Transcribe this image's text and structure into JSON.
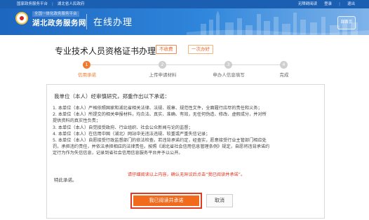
{
  "topbar": {
    "site_name": "国家政务服务平台",
    "province_portal": "湖北省人民政府",
    "accessibility": "无障碍阅读",
    "login": "登录",
    "logout": "退出"
  },
  "header": {
    "logo_tagline": "全国一体化政务服务平台",
    "logo_name": "湖北政务服务网",
    "section_title": "在线办理",
    "home_button": "回首页"
  },
  "page": {
    "title": "专业技术人员资格证书办理",
    "fee_badge": "不收费",
    "once_badge": "一次办好"
  },
  "steps": [
    {
      "number": "1",
      "label": "信用承诺",
      "active": true
    },
    {
      "number": "2",
      "label": "上传申请材料",
      "active": false
    },
    {
      "number": "3",
      "label": "申办人信息填写",
      "active": false
    },
    {
      "number": "4",
      "label": "完成",
      "active": false
    }
  ],
  "commitment": {
    "intro": "我单位（本人）经审慎研究，郑重作出以下承诺：",
    "clauses": [
      "1. 本单位（本人）严格依照国家和湖北省相关法律、法规、规章、规范性文件，全面履行应尽的责任和义务；",
      "2. 本单位（本人）所提交的相关申报材料，均合法、真实、准确、有效，无任何伪造、修改、虚假成分，并对所",
      "提供资料的真实性负责；",
      "3. 本单位（本人）自觉接受政府、行业组织、社会公众新闻与论的监督；",
      "4. 本单位（本人）在信用中国（湖北）网站中无违法违规、较重或严重失信记录；",
      "5. 本单位（本人）自愿接受行政监督部门的依法检查。若违背承诺约定，经查实，愿意接受行业主管部门相应处",
      "罚，承担违约责任，并依法承担相应的法律责任。按照《湖北省社会信用信息管理条例》规定，自愿将违背承诺约",
      "定行为作为失信信息，记录到省社会信用信息服务平台并予以公开。"
    ],
    "hint": "请仔细阅读以上内容，确认无异议后点击“我已阅读并承诺”。",
    "closing": "特此承诺。",
    "confirm_button": "我已阅读并承诺",
    "cancel_button": "取消"
  },
  "colors": {
    "brand_blue": "#1b5fb2",
    "accent_orange": "#f26a1c",
    "hint_red": "#e0321f"
  }
}
